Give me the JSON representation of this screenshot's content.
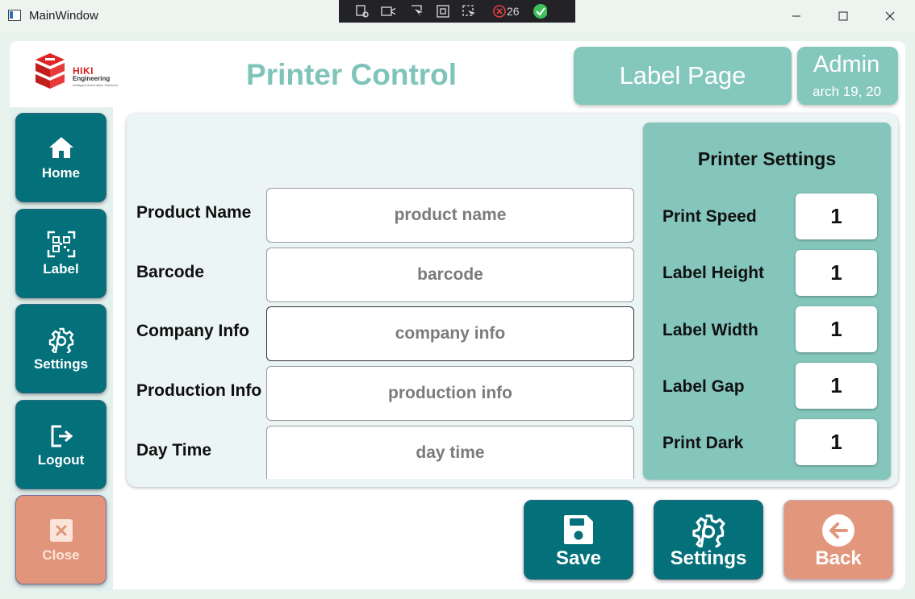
{
  "window": {
    "title": "MainWindow",
    "capture_count": "26"
  },
  "header": {
    "page_title": "Printer Control",
    "label_page_button": "Label Page",
    "user_name": "Admin",
    "date_text": "arch 19, 20",
    "logo_line1": "HIKI",
    "logo_line2": "Engineering",
    "logo_line3": "Intelligent Automation Solutions"
  },
  "sidebar": {
    "items": [
      {
        "label": "Home",
        "icon": "home-icon"
      },
      {
        "label": "Label",
        "icon": "qr-code-icon"
      },
      {
        "label": "Settings",
        "icon": "gear-icon"
      },
      {
        "label": "Logout",
        "icon": "logout-icon"
      },
      {
        "label": "Close",
        "icon": "close-icon"
      }
    ]
  },
  "form": {
    "fields": [
      {
        "label": "Product Name",
        "placeholder": "product name",
        "value": ""
      },
      {
        "label": "Barcode",
        "placeholder": "barcode",
        "value": ""
      },
      {
        "label": "Company Info",
        "placeholder": "company info",
        "value": ""
      },
      {
        "label": "Production Info",
        "placeholder": "production info",
        "value": ""
      },
      {
        "label": "Day Time",
        "placeholder": "day time",
        "value": ""
      }
    ]
  },
  "printer_settings": {
    "title": "Printer Settings",
    "items": [
      {
        "label": "Print Speed",
        "value": "1"
      },
      {
        "label": "Label Height",
        "value": "1"
      },
      {
        "label": "Label Width",
        "value": "1"
      },
      {
        "label": "Label Gap",
        "value": "1"
      },
      {
        "label": "Print Dark",
        "value": "1"
      }
    ]
  },
  "actions": {
    "save": "Save",
    "settings": "Settings",
    "back": "Back"
  },
  "colors": {
    "primary_teal": "#03707a",
    "light_teal": "#84c7bc",
    "title_teal": "#7fc4ba",
    "salmon": "#e2977d"
  }
}
